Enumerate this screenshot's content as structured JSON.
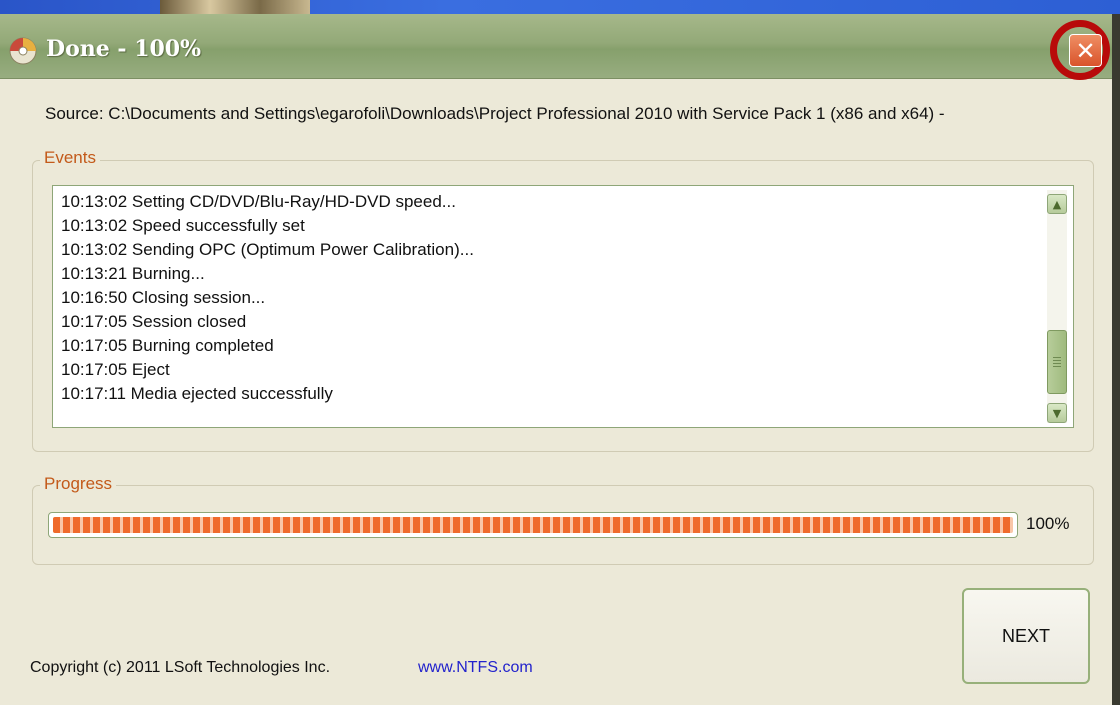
{
  "window": {
    "title": "Done - 100%",
    "close_glyph": "✕",
    "icon": "disc-icon"
  },
  "source_line": "Source: C:\\Documents and Settings\\egarofoli\\Downloads\\Project Professional 2010 with Service Pack 1 (x86 and x64) -",
  "events": {
    "label": "Events",
    "lines": [
      "10:13:02 Setting CD/DVD/Blu-Ray/HD-DVD speed...",
      "10:13:02 Speed successfully set",
      "10:13:02 Sending OPC (Optimum Power Calibration)...",
      "10:13:21 Burning...",
      "10:16:50 Closing session...",
      "10:17:05 Session closed",
      "10:17:05 Burning completed",
      "10:17:05 Eject",
      "10:17:11 Media ejected successfully"
    ]
  },
  "progress": {
    "label": "Progress",
    "value": 1.0,
    "percent_text": "100%"
  },
  "next_label": "NEXT",
  "footer": {
    "copyright": "Copyright (c) 2011 LSoft Technologies Inc.",
    "link": "www.NTFS.com"
  },
  "colors": {
    "titlebar": "#93a978",
    "group_label": "#c35a1a",
    "progress_fill": "#ef6a2c",
    "close_highlight": "#b80a0a",
    "link": "#2222cc"
  }
}
